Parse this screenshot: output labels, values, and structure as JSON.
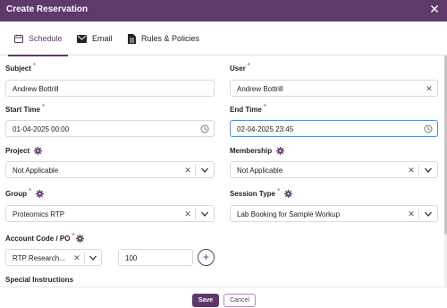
{
  "dialog": {
    "title": "Create Reservation"
  },
  "tabs": [
    {
      "label": "Schedule",
      "icon": "calendar-icon",
      "active": true
    },
    {
      "label": "Email",
      "icon": "envelope-icon",
      "active": false
    },
    {
      "label": "Rules & Policies",
      "icon": "document-icon",
      "active": false
    }
  ],
  "form": {
    "subject": {
      "label": "Subject",
      "value": "Andrew Bottrill"
    },
    "user": {
      "label": "User",
      "value": "Andrew Bottrill"
    },
    "start_time": {
      "label": "Start Time",
      "value": "01-04-2025 00:00"
    },
    "end_time": {
      "label": "End Time",
      "value": "02-04-2025 23:45"
    },
    "project": {
      "label": "Project",
      "value": "Not Applicable"
    },
    "membership": {
      "label": "Membership",
      "value": "Not Applicable"
    },
    "group": {
      "label": "Group",
      "value": "Proteomics RTP"
    },
    "session_type": {
      "label": "Session Type",
      "value": "Lab Booking for Sample Workup"
    },
    "account_code": {
      "label": "Account Code / PO",
      "value": "RTP Research...",
      "amount": "100"
    },
    "special_instructions": {
      "label": "Special Instructions"
    }
  },
  "footer": {
    "save_label": "Save",
    "cancel_label": "Cancel"
  },
  "colors": {
    "brand": "#5d3a6a",
    "required": "#d93c3c",
    "focus": "#5b8ec9"
  }
}
